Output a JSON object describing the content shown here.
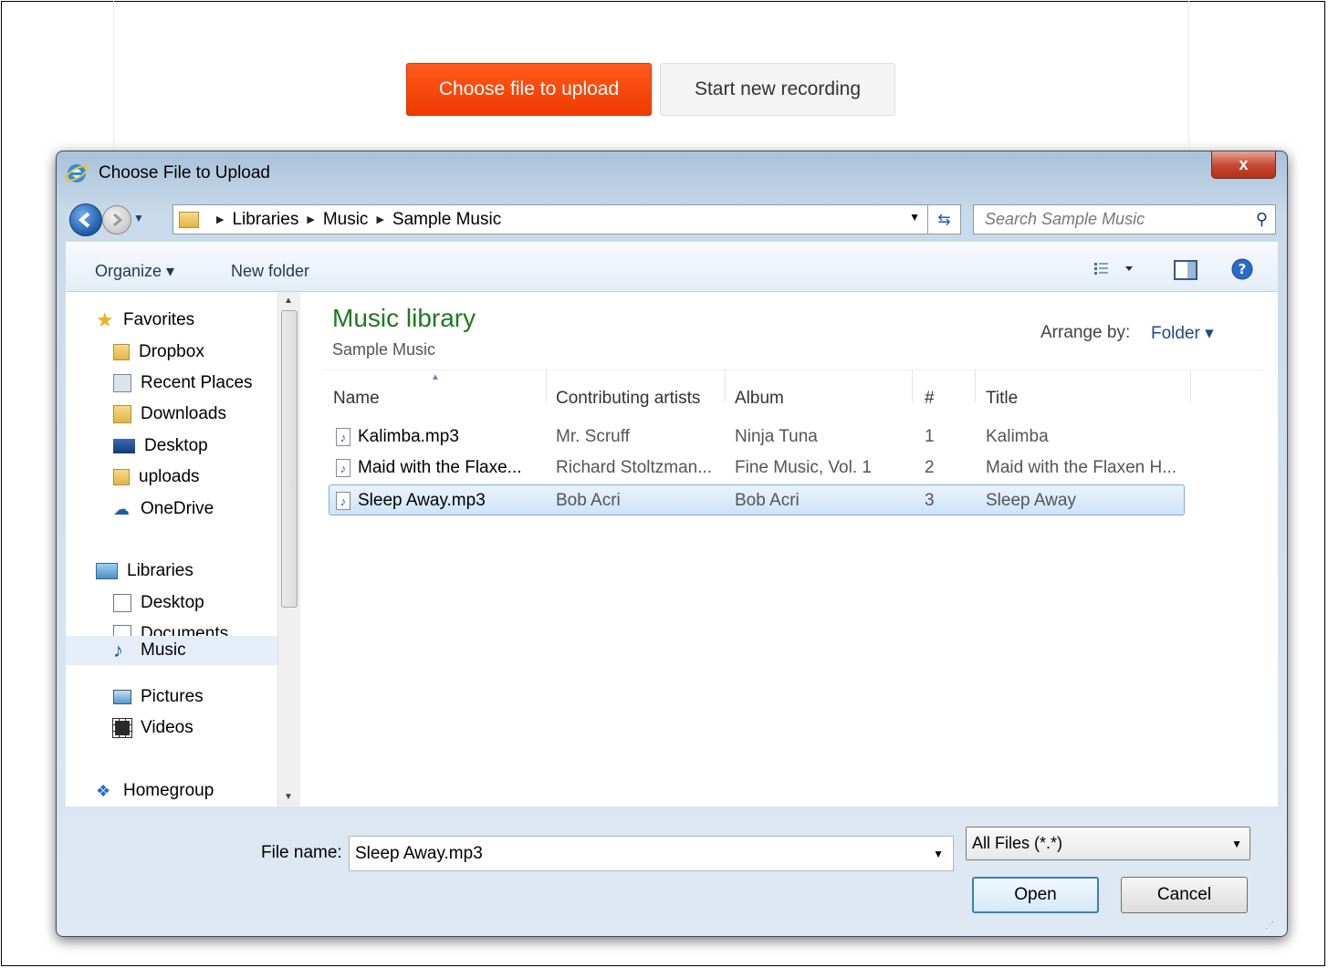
{
  "page": {
    "upload_button": "Choose file to upload",
    "record_button": "Start new recording"
  },
  "dialog": {
    "title": "Choose File to Upload",
    "close_label": "x",
    "breadcrumbs": [
      "Libraries",
      "Music",
      "Sample Music"
    ],
    "search_placeholder": "Search Sample Music",
    "toolbar": {
      "organize": "Organize ▾",
      "new_folder": "New folder"
    },
    "nav": {
      "favorites_header": "Favorites",
      "favorites": [
        "Dropbox",
        "Recent Places",
        "Downloads",
        "Desktop",
        "uploads",
        "OneDrive"
      ],
      "libraries_header": "Libraries",
      "libraries": [
        "Desktop",
        "Documents",
        "Music",
        "Pictures",
        "Videos"
      ],
      "homegroup": "Homegroup",
      "selected": "Music"
    },
    "content": {
      "library_title": "Music library",
      "library_subtitle": "Sample Music",
      "arrange_label": "Arrange by:",
      "arrange_value": "Folder ▾",
      "columns": [
        "Name",
        "Contributing artists",
        "Album",
        "#",
        "Title"
      ],
      "rows": [
        {
          "name": "Kalimba.mp3",
          "artist": "Mr. Scruff",
          "album": "Ninja Tuna",
          "num": "1",
          "title": "Kalimba"
        },
        {
          "name": "Maid with the Flaxe...",
          "artist": "Richard Stoltzman...",
          "album": "Fine Music, Vol. 1",
          "num": "2",
          "title": "Maid with the Flaxen H..."
        },
        {
          "name": "Sleep Away.mp3",
          "artist": "Bob Acri",
          "album": "Bob Acri",
          "num": "3",
          "title": "Sleep Away"
        }
      ],
      "selected_row": 2
    },
    "bottom": {
      "filename_label": "File name:",
      "filename_value": "Sleep Away.mp3",
      "filter": "All Files (*.*)",
      "open": "Open",
      "cancel": "Cancel"
    }
  },
  "colors": {
    "upload_accent": "#f04a0c",
    "library_title": "#1e7a1e",
    "selection": "#cfe2f8"
  }
}
